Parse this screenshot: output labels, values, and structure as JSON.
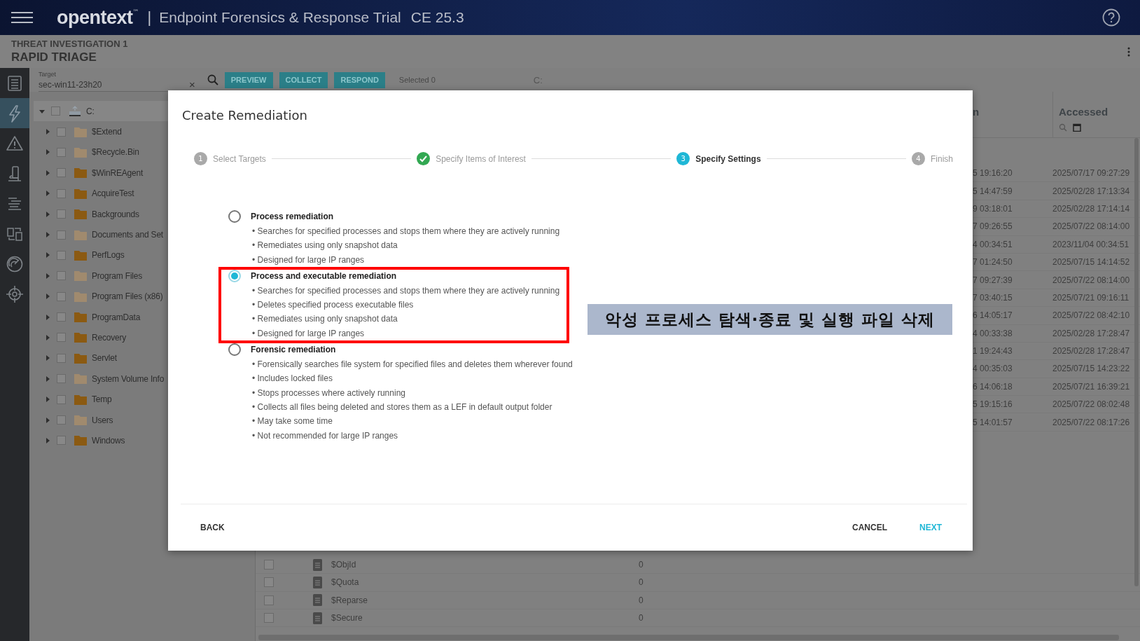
{
  "header": {
    "logo": "opentext",
    "logo_mark": "™",
    "separator": "|",
    "title": "Endpoint Forensics & Response Trial",
    "version": "CE 25.3"
  },
  "subheader": {
    "section": "THREAT INVESTIGATION 1",
    "title": "RAPID TRIAGE"
  },
  "rail": [
    {
      "selected": false
    },
    {
      "selected": true
    },
    {
      "selected": false
    },
    {
      "selected": false
    },
    {
      "selected": false
    },
    {
      "selected": false
    },
    {
      "selected": false
    },
    {
      "selected": false
    }
  ],
  "toolbar": {
    "target_label": "Target",
    "target_value": "sec-win11-23h20",
    "clear": "×",
    "buttons": [
      "PREVIEW",
      "COLLECT",
      "RESPOND"
    ],
    "selected_count": "Selected 0",
    "path": "C:"
  },
  "tree": [
    {
      "name": "C:",
      "kind": "drive",
      "expanded": true,
      "selected": true,
      "checked": false,
      "children": [
        {
          "name": "$Extend",
          "kind": "folder",
          "hidden": true,
          "expanded": false,
          "checked": false
        },
        {
          "name": "$Recycle.Bin",
          "kind": "folder",
          "hidden": true,
          "expanded": false,
          "checked": false
        },
        {
          "name": "$WinREAgent",
          "kind": "folder",
          "hidden": false,
          "expanded": false,
          "checked": false
        },
        {
          "name": "AcquireTest",
          "kind": "folder",
          "hidden": false,
          "expanded": false,
          "checked": false
        },
        {
          "name": "Backgrounds",
          "kind": "folder",
          "hidden": false,
          "expanded": false,
          "checked": false
        },
        {
          "name": "Documents and Set",
          "kind": "folder",
          "hidden": true,
          "expanded": false,
          "checked": false
        },
        {
          "name": "PerfLogs",
          "kind": "folder",
          "hidden": false,
          "expanded": false,
          "checked": false
        },
        {
          "name": "Program Files",
          "kind": "folder",
          "hidden": true,
          "expanded": false,
          "checked": false
        },
        {
          "name": "Program Files (x86)",
          "kind": "folder",
          "hidden": true,
          "expanded": false,
          "checked": false
        },
        {
          "name": "ProgramData",
          "kind": "folder",
          "hidden": false,
          "expanded": false,
          "checked": false
        },
        {
          "name": "Recovery",
          "kind": "folder",
          "hidden": false,
          "expanded": false,
          "checked": false
        },
        {
          "name": "Servlet",
          "kind": "folder",
          "hidden": false,
          "expanded": false,
          "checked": false
        },
        {
          "name": "System Volume Info",
          "kind": "folder",
          "hidden": true,
          "expanded": false,
          "checked": false
        },
        {
          "name": "Temp",
          "kind": "folder",
          "hidden": false,
          "expanded": false,
          "checked": false
        },
        {
          "name": "Users",
          "kind": "folder",
          "hidden": true,
          "expanded": false,
          "checked": false
        },
        {
          "name": "Windows",
          "kind": "folder",
          "hidden": false,
          "expanded": false,
          "checked": false
        }
      ]
    }
  ],
  "table": {
    "columns": [
      {
        "label": "n"
      },
      {
        "label": "Accessed"
      }
    ],
    "rows": [
      {
        "column_1": "5 19:16:20",
        "accessed": "2025/07/17 09:27:29"
      },
      {
        "column_1": "5 14:47:59",
        "accessed": "2025/02/28 17:13:34"
      },
      {
        "column_1": "9 03:18:01",
        "accessed": "2025/02/28 17:14:14"
      },
      {
        "column_1": "7 09:26:55",
        "accessed": "2025/07/22 08:14:00"
      },
      {
        "column_1": "4 00:34:51",
        "accessed": "2023/11/04 00:34:51"
      },
      {
        "column_1": "7 01:24:50",
        "accessed": "2025/07/15 14:14:52"
      },
      {
        "column_1": "7 09:27:39",
        "accessed": "2025/07/22 08:14:00"
      },
      {
        "column_1": "7 03:40:15",
        "accessed": "2025/07/21 09:16:11"
      },
      {
        "column_1": "6 14:05:17",
        "accessed": "2025/07/22 08:42:10"
      },
      {
        "column_1": "4 00:33:38",
        "accessed": "2025/02/28 17:28:47"
      },
      {
        "column_1": "1 19:24:43",
        "accessed": "2025/02/28 17:28:47"
      },
      {
        "column_1": "4 00:35:03",
        "accessed": "2025/07/15 14:23:22"
      },
      {
        "column_1": "6 14:06:18",
        "accessed": "2025/07/21 16:39:21"
      },
      {
        "column_1": "5 19:15:16",
        "accessed": "2025/07/22 08:02:48"
      },
      {
        "column_1": "5 14:01:57",
        "accessed": "2025/07/22 08:17:26"
      }
    ],
    "lower_rows": [
      {
        "name": "$ObjId",
        "size": "0",
        "checked": false
      },
      {
        "name": "$Quota",
        "size": "0",
        "checked": false
      },
      {
        "name": "$Reparse",
        "size": "0",
        "checked": false
      },
      {
        "name": "$Secure",
        "size": "0",
        "checked": false
      }
    ]
  },
  "dialog": {
    "title": "Create Remediation",
    "steps": [
      {
        "number": "1",
        "label": "Select Targets",
        "done": false,
        "current": false
      },
      {
        "label": "Specify Items of Interest",
        "done": true,
        "current": false
      },
      {
        "number": "3",
        "label": "Specify Settings",
        "done": false,
        "current": true
      },
      {
        "number": "4",
        "label": "Finish",
        "done": false,
        "current": false
      }
    ],
    "options": [
      {
        "title": "Process remediation",
        "selected": false,
        "highlighted": false,
        "bullets": [
          "• Searches for specified processes and stops them where they are actively running",
          "• Remediates using only snapshot data",
          "• Designed for large IP ranges"
        ]
      },
      {
        "title": "Process and executable remediation",
        "selected": true,
        "highlighted": true,
        "bullets": [
          "• Searches for specified processes and stops them where they are actively running",
          "• Deletes specified process executable files",
          "• Remediates using only snapshot data",
          "• Designed for large IP ranges"
        ]
      },
      {
        "title": "Forensic remediation",
        "selected": false,
        "highlighted": false,
        "bullets": [
          "• Forensically searches file system for specified files and deletes them wherever found",
          "• Includes locked files",
          "• Stops processes where actively running",
          "• Collects all files being deleted and stores them as a LEF in default output folder",
          "• May take some time",
          "• Not recommended for large IP ranges"
        ]
      }
    ],
    "buttons": [
      {
        "label": "BACK",
        "kind": "plain"
      },
      {
        "label": "CANCEL",
        "kind": "plain"
      },
      {
        "label": "NEXT",
        "kind": "primary"
      }
    ]
  },
  "caption": "악성 프로세스 탐색·종료 및 실행 파일 삭제"
}
